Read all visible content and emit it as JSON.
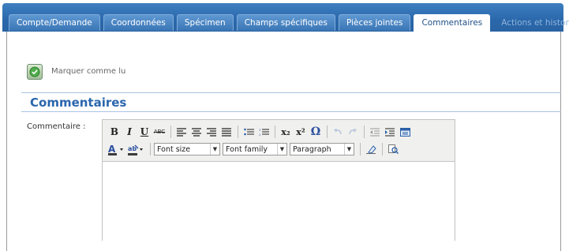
{
  "tabs": [
    {
      "label": "Compte/Demande",
      "state": "normal"
    },
    {
      "label": "Coordonnées",
      "state": "normal"
    },
    {
      "label": "Spécimen",
      "state": "normal"
    },
    {
      "label": "Champs spécifiques",
      "state": "normal"
    },
    {
      "label": "Pièces jointes",
      "state": "normal"
    },
    {
      "label": "Commentaires",
      "state": "active"
    },
    {
      "label": "Actions et historique",
      "state": "disabled"
    }
  ],
  "mark_read": {
    "label": "Marquer comme lu",
    "icon": "check-circle-icon"
  },
  "section": {
    "title": "Commentaires"
  },
  "comment_field": {
    "label": "Commentaire :",
    "value": ""
  },
  "toolbar": {
    "bold": "B",
    "italic": "I",
    "underline": "U",
    "strike": "ABC",
    "subscript": "x₂",
    "superscript": "x²",
    "omega": "Ω",
    "font_size": "Font size",
    "font_family": "Font family",
    "format": "Paragraph"
  },
  "colors": {
    "tabbar": "#2a68ab",
    "accent": "#2a66ad",
    "active_tab_text": "#1f4f86"
  }
}
